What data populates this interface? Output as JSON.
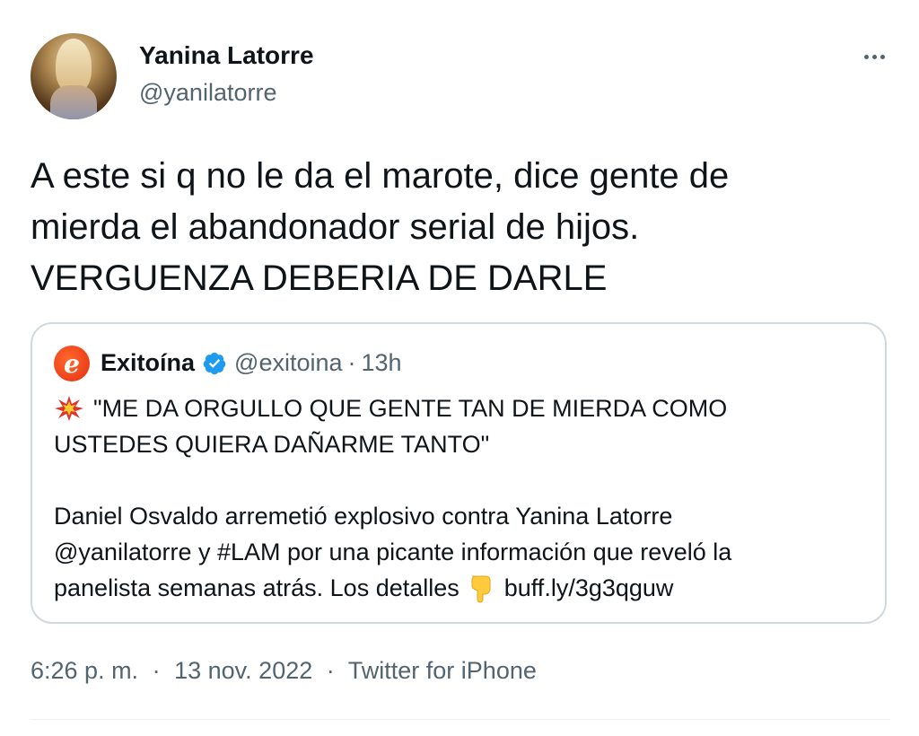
{
  "tweet": {
    "author": {
      "display_name": "Yanina Latorre",
      "handle": "@yanilatorre"
    },
    "more_icon": "more-horizontal-icon",
    "text_lines": [
      "A este si q no le da el marote, dice gente de",
      "mierda el abandonador serial de hijos.",
      "VERGUENZA DEBERIA DE DARLE"
    ],
    "quoted": {
      "display_name": "Exitoína",
      "avatar_letter": "e",
      "verified_icon": "verified-badge-icon",
      "handle": "@exitoina",
      "separator": "·",
      "time": "13h",
      "line1": "\"ME DA ORGULLO QUE GENTE TAN DE MIERDA COMO",
      "line2": "USTEDES QUIERA DAÑARME TANTO\"",
      "line3": "Daniel Osvaldo arremetió explosivo contra Yanina Latorre",
      "line4": "@yanilatorre y #LAM por una picante información que reveló la",
      "line5_text": "panelista semanas atrás. Los detalles",
      "line5_link": "buff.ly/3g3qguw",
      "boom_icon": "collision-emoji-icon",
      "point_icon": "pointing-down-emoji-icon"
    },
    "meta": {
      "time": "6:26 p. m.",
      "separator": "·",
      "date": "13 nov. 2022",
      "source": "Twitter for iPhone"
    },
    "colors": {
      "text": "#0f1419",
      "secondary": "#536471",
      "border": "#cfd9de",
      "verified": "#1d9bf0"
    }
  }
}
